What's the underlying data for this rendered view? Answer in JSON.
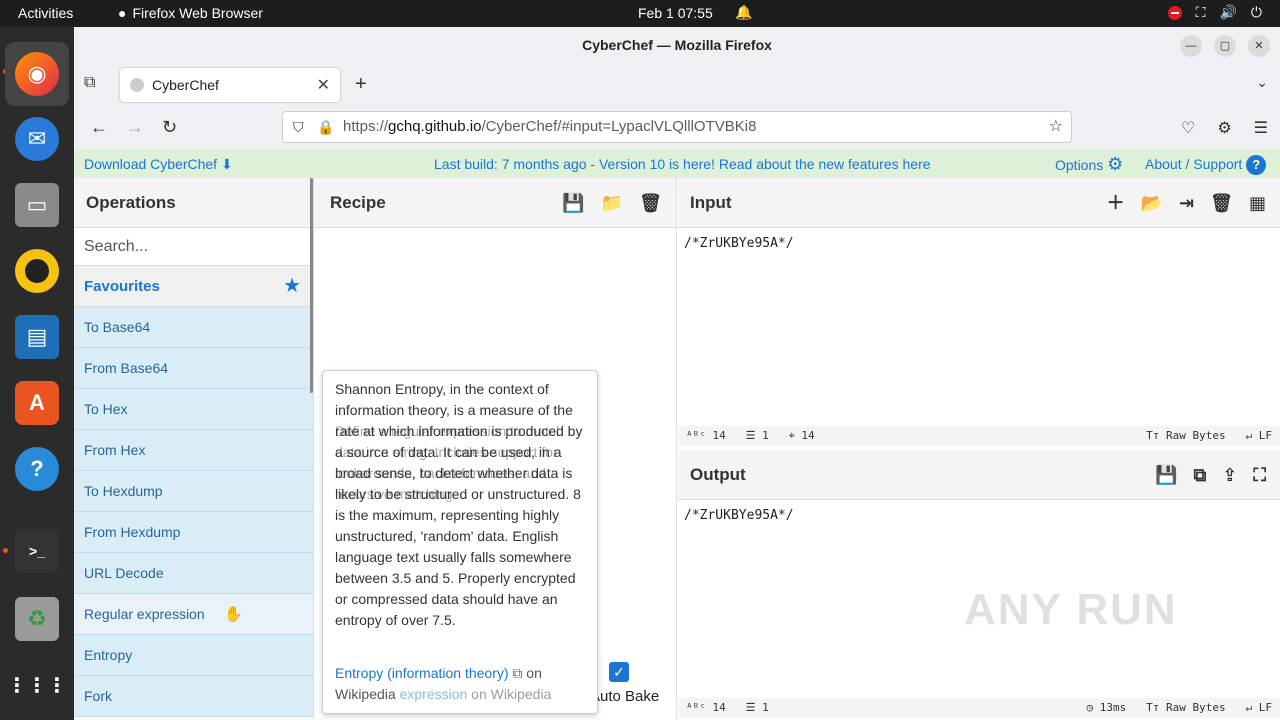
{
  "topbar": {
    "activities": "Activities",
    "app_name": "Firefox Web Browser",
    "clock": "Feb 1  07:55"
  },
  "window": {
    "title": "CyberChef — Mozilla Firefox",
    "tab_title": "CyberChef",
    "url_prefix": "https://",
    "url_domain": "gchq.github.io",
    "url_rest": "/CyberChef/#input=LypaclVLQlllOTVBKi8"
  },
  "banner": {
    "download": "Download CyberChef",
    "middle": "Last build: 7 months ago - Version 10 is here! Read about the new features here",
    "options": "Options",
    "about": "About / Support"
  },
  "operations": {
    "title": "Operations",
    "search_placeholder": "Search...",
    "favourites": "Favourites",
    "items": [
      "To Base64",
      "From Base64",
      "To Hex",
      "From Hex",
      "To Hexdump",
      "From Hexdump",
      "URL Decode",
      "Regular expression",
      "Entropy",
      "Fork"
    ]
  },
  "recipe": {
    "title": "Recipe",
    "auto_bake": "Auto Bake"
  },
  "input": {
    "title": "Input",
    "text": "/*ZrUKBYe95A*/",
    "status_chars": "14",
    "status_lines": "1",
    "status_pos": "14",
    "encoding": "Raw Bytes",
    "eol": "LF"
  },
  "output": {
    "title": "Output",
    "text": "/*ZrUKBYe95A*/",
    "status_chars": "14",
    "status_lines": "1",
    "time": "13ms",
    "encoding": "Raw Bytes",
    "eol": "LF"
  },
  "tooltip": {
    "text": "Shannon Entropy, in the context of information theory, is a measure of the rate at which information is produced by a source of data. It can be used, in a broad sense, to detect whether data is likely to be structured or unstructured. 8 is the maximum, representing highly unstructured, 'random' data. English language text usually falls somewhere between 3.5 and 5. Properly encrypted or compressed data should have an entropy of over 7.5.",
    "ghost": "Define a regular expression to match data in a string. Includes support for lookarounds, backreferences, and recursive matching.",
    "link1": "Entropy (information theory)",
    "link1_suffix": " on",
    "link2": "Wikipedia",
    "ghost_link": "expression",
    "ghost_link_suffix": " on Wikipedia"
  },
  "watermark": "ANY RUN"
}
